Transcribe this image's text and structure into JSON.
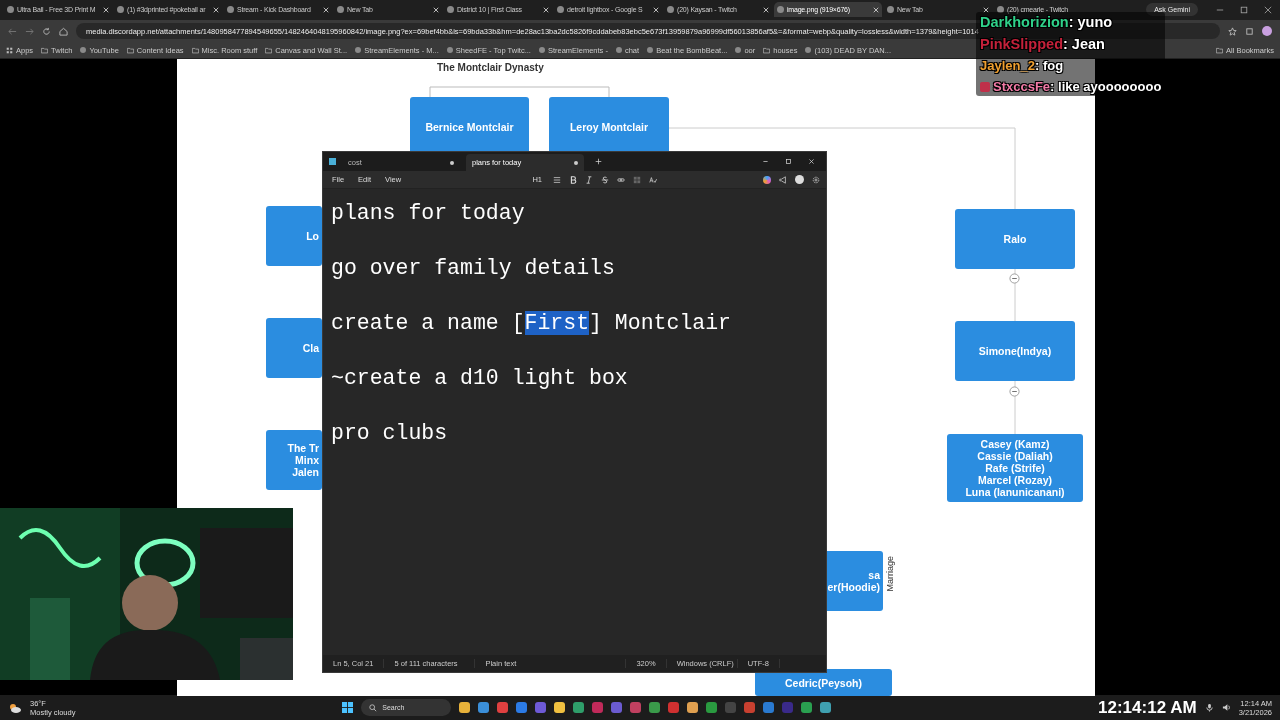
{
  "browser": {
    "tabs": [
      {
        "title": "Ultra Ball - Free 3D Print M",
        "selected": false
      },
      {
        "title": "(1) #3dprinted #pokeball ar",
        "selected": false
      },
      {
        "title": "Stream - Kick Dashboard",
        "selected": false
      },
      {
        "title": "New Tab",
        "selected": false
      },
      {
        "title": "District 10 | First Class",
        "selected": false
      },
      {
        "title": "detroit lightbox - Google S",
        "selected": false
      },
      {
        "title": "(20) Kaysan - Twitch",
        "selected": false
      },
      {
        "title": "image.png (919×676)",
        "selected": true
      },
      {
        "title": "New Tab",
        "selected": false
      },
      {
        "title": "(20) cmearle - Twitch",
        "selected": false
      }
    ],
    "ask_button": "Ask Gemini",
    "address": "media.discordapp.net/attachments/1480958477894549655/1482464048195960842/image.png?ex=69bef4bb&is=69bda33b&hm=de28ac13ba2dc5826f9cddabeb83ebc5e673f13959879a96999df56013856af5&=&format=webp&quality=lossless&width=1379&height=1014",
    "bookmarks": [
      {
        "label": "Apps",
        "kind": "apps"
      },
      {
        "label": "Twitch",
        "kind": "folder"
      },
      {
        "label": "YouTube",
        "kind": "site"
      },
      {
        "label": "Content Ideas",
        "kind": "folder"
      },
      {
        "label": "Misc. Room stuff",
        "kind": "folder"
      },
      {
        "label": "Canvas and Wall St...",
        "kind": "folder"
      },
      {
        "label": "StreamElements - M...",
        "kind": "site"
      },
      {
        "label": "SheedFE - Top Twitc...",
        "kind": "site"
      },
      {
        "label": "StreamElements -",
        "kind": "site"
      },
      {
        "label": "chat",
        "kind": "site"
      },
      {
        "label": "Beat the BombBeat...",
        "kind": "site"
      },
      {
        "label": "oor",
        "kind": "site"
      },
      {
        "label": "houses",
        "kind": "folder"
      },
      {
        "label": "(103) DEAD BY DAN...",
        "kind": "site"
      }
    ],
    "all_bookmarks": "All Bookmarks"
  },
  "diagram": {
    "title": "The Montclair Dynasty",
    "nodes": [
      {
        "lines": [
          "Bernice Montclair"
        ]
      },
      {
        "lines": [
          "Leroy Montclair"
        ]
      },
      {
        "lines": [
          "Lo"
        ]
      },
      {
        "lines": [
          "Cla"
        ]
      },
      {
        "lines": [
          "The Tr",
          "Minx",
          "Jalen"
        ]
      },
      {
        "lines": [
          "Ralo"
        ]
      },
      {
        "lines": [
          "Simone(Indya)"
        ]
      },
      {
        "lines": [
          "Casey (Kamz)",
          "Cassie (Daliah)",
          "Rafe (Strife)",
          "Marcel (Rozay)",
          "Luna (lanunicanani)"
        ]
      },
      {
        "lines": [
          "sa",
          "er(Hoodie)"
        ]
      },
      {
        "lines": [
          "Cedric(Peysoh)"
        ]
      }
    ],
    "edge_label": "Marriage"
  },
  "notepad": {
    "tabs": [
      {
        "title": "cost",
        "selected": false,
        "modified": true
      },
      {
        "title": "plans for today",
        "selected": true,
        "modified": true
      }
    ],
    "menu": [
      "File",
      "Edit",
      "View"
    ],
    "heading_button": "H1",
    "lines": [
      {
        "parts": [
          {
            "text": "plans for today",
            "selected": false
          }
        ]
      },
      {
        "parts": [
          {
            "text": "go over family details",
            "selected": false
          }
        ]
      },
      {
        "parts": [
          {
            "text": "create a name [",
            "selected": false
          },
          {
            "text": "First",
            "selected": true
          },
          {
            "text": "] Montclair",
            "selected": false
          }
        ]
      },
      {
        "parts": [
          {
            "text": "~create a d10 light box",
            "selected": false
          }
        ]
      },
      {
        "parts": [
          {
            "text": "pro clubs",
            "selected": false
          }
        ]
      }
    ],
    "status": [
      "Ln 5, Col 21",
      "5 of 111 characters",
      "Plain text",
      "320%",
      "Windows (CRLF)",
      "UTF-8"
    ]
  },
  "chat": [
    {
      "name": "Darkhorizion",
      "message": ": yuno",
      "color": "#2fd18a"
    },
    {
      "name": "PinkSlipped",
      "message": ": Jean",
      "color": "#c4213a"
    },
    {
      "name": "Jaylen_2",
      "message": ": fog",
      "color": "#f0a030"
    },
    {
      "name": "StxccsFe",
      "message": ": like ayoooooooo",
      "color": "#f27aa6"
    }
  ],
  "taskbar": {
    "temperature": "36°F",
    "weather": "Mostly cloudy",
    "search": "Search",
    "apps": [
      {
        "color": "#e8b23a"
      },
      {
        "color": "#3b8fd9"
      },
      {
        "color": "#e04040"
      },
      {
        "color": "#2c7be5"
      },
      {
        "color": "#6e5ad6"
      },
      {
        "color": "#f0c040"
      },
      {
        "color": "#2f9e6a"
      },
      {
        "color": "#c02a5a"
      },
      {
        "color": "#6b5bd0"
      },
      {
        "color": "#c04060"
      },
      {
        "color": "#3a9a4a"
      },
      {
        "color": "#d03030"
      },
      {
        "color": "#e0a050"
      },
      {
        "color": "#2a9a40"
      },
      {
        "color": "#444444"
      },
      {
        "color": "#c84030"
      },
      {
        "color": "#2a7ad0"
      },
      {
        "color": "#3a2a8a"
      },
      {
        "color": "#2aa050"
      },
      {
        "color": "#3fa0b0"
      }
    ],
    "stream_time": "12:14:12 AM",
    "clock": "12:14 AM",
    "date": "3/21/2026"
  }
}
